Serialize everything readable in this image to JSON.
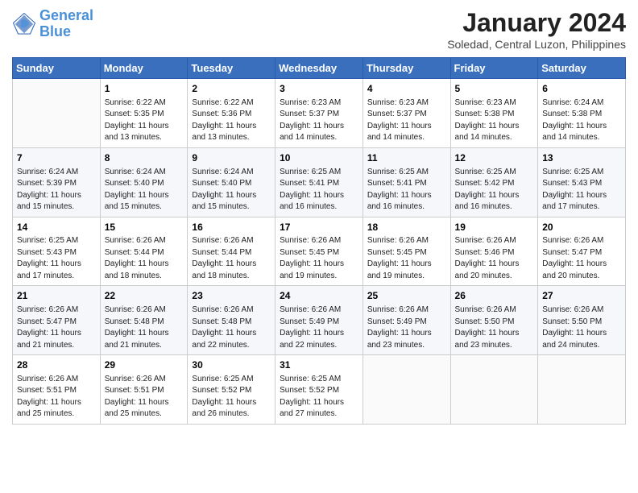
{
  "header": {
    "logo_line1": "General",
    "logo_line2": "Blue",
    "title": "January 2024",
    "subtitle": "Soledad, Central Luzon, Philippines"
  },
  "weekdays": [
    "Sunday",
    "Monday",
    "Tuesday",
    "Wednesday",
    "Thursday",
    "Friday",
    "Saturday"
  ],
  "weeks": [
    [
      {
        "day": "",
        "content": ""
      },
      {
        "day": "1",
        "content": "Sunrise: 6:22 AM\nSunset: 5:35 PM\nDaylight: 11 hours\nand 13 minutes."
      },
      {
        "day": "2",
        "content": "Sunrise: 6:22 AM\nSunset: 5:36 PM\nDaylight: 11 hours\nand 13 minutes."
      },
      {
        "day": "3",
        "content": "Sunrise: 6:23 AM\nSunset: 5:37 PM\nDaylight: 11 hours\nand 14 minutes."
      },
      {
        "day": "4",
        "content": "Sunrise: 6:23 AM\nSunset: 5:37 PM\nDaylight: 11 hours\nand 14 minutes."
      },
      {
        "day": "5",
        "content": "Sunrise: 6:23 AM\nSunset: 5:38 PM\nDaylight: 11 hours\nand 14 minutes."
      },
      {
        "day": "6",
        "content": "Sunrise: 6:24 AM\nSunset: 5:38 PM\nDaylight: 11 hours\nand 14 minutes."
      }
    ],
    [
      {
        "day": "7",
        "content": "Sunrise: 6:24 AM\nSunset: 5:39 PM\nDaylight: 11 hours\nand 15 minutes."
      },
      {
        "day": "8",
        "content": "Sunrise: 6:24 AM\nSunset: 5:40 PM\nDaylight: 11 hours\nand 15 minutes."
      },
      {
        "day": "9",
        "content": "Sunrise: 6:24 AM\nSunset: 5:40 PM\nDaylight: 11 hours\nand 15 minutes."
      },
      {
        "day": "10",
        "content": "Sunrise: 6:25 AM\nSunset: 5:41 PM\nDaylight: 11 hours\nand 16 minutes."
      },
      {
        "day": "11",
        "content": "Sunrise: 6:25 AM\nSunset: 5:41 PM\nDaylight: 11 hours\nand 16 minutes."
      },
      {
        "day": "12",
        "content": "Sunrise: 6:25 AM\nSunset: 5:42 PM\nDaylight: 11 hours\nand 16 minutes."
      },
      {
        "day": "13",
        "content": "Sunrise: 6:25 AM\nSunset: 5:43 PM\nDaylight: 11 hours\nand 17 minutes."
      }
    ],
    [
      {
        "day": "14",
        "content": "Sunrise: 6:25 AM\nSunset: 5:43 PM\nDaylight: 11 hours\nand 17 minutes."
      },
      {
        "day": "15",
        "content": "Sunrise: 6:26 AM\nSunset: 5:44 PM\nDaylight: 11 hours\nand 18 minutes."
      },
      {
        "day": "16",
        "content": "Sunrise: 6:26 AM\nSunset: 5:44 PM\nDaylight: 11 hours\nand 18 minutes."
      },
      {
        "day": "17",
        "content": "Sunrise: 6:26 AM\nSunset: 5:45 PM\nDaylight: 11 hours\nand 19 minutes."
      },
      {
        "day": "18",
        "content": "Sunrise: 6:26 AM\nSunset: 5:45 PM\nDaylight: 11 hours\nand 19 minutes."
      },
      {
        "day": "19",
        "content": "Sunrise: 6:26 AM\nSunset: 5:46 PM\nDaylight: 11 hours\nand 20 minutes."
      },
      {
        "day": "20",
        "content": "Sunrise: 6:26 AM\nSunset: 5:47 PM\nDaylight: 11 hours\nand 20 minutes."
      }
    ],
    [
      {
        "day": "21",
        "content": "Sunrise: 6:26 AM\nSunset: 5:47 PM\nDaylight: 11 hours\nand 21 minutes."
      },
      {
        "day": "22",
        "content": "Sunrise: 6:26 AM\nSunset: 5:48 PM\nDaylight: 11 hours\nand 21 minutes."
      },
      {
        "day": "23",
        "content": "Sunrise: 6:26 AM\nSunset: 5:48 PM\nDaylight: 11 hours\nand 22 minutes."
      },
      {
        "day": "24",
        "content": "Sunrise: 6:26 AM\nSunset: 5:49 PM\nDaylight: 11 hours\nand 22 minutes."
      },
      {
        "day": "25",
        "content": "Sunrise: 6:26 AM\nSunset: 5:49 PM\nDaylight: 11 hours\nand 23 minutes."
      },
      {
        "day": "26",
        "content": "Sunrise: 6:26 AM\nSunset: 5:50 PM\nDaylight: 11 hours\nand 23 minutes."
      },
      {
        "day": "27",
        "content": "Sunrise: 6:26 AM\nSunset: 5:50 PM\nDaylight: 11 hours\nand 24 minutes."
      }
    ],
    [
      {
        "day": "28",
        "content": "Sunrise: 6:26 AM\nSunset: 5:51 PM\nDaylight: 11 hours\nand 25 minutes."
      },
      {
        "day": "29",
        "content": "Sunrise: 6:26 AM\nSunset: 5:51 PM\nDaylight: 11 hours\nand 25 minutes."
      },
      {
        "day": "30",
        "content": "Sunrise: 6:25 AM\nSunset: 5:52 PM\nDaylight: 11 hours\nand 26 minutes."
      },
      {
        "day": "31",
        "content": "Sunrise: 6:25 AM\nSunset: 5:52 PM\nDaylight: 11 hours\nand 27 minutes."
      },
      {
        "day": "",
        "content": ""
      },
      {
        "day": "",
        "content": ""
      },
      {
        "day": "",
        "content": ""
      }
    ]
  ]
}
